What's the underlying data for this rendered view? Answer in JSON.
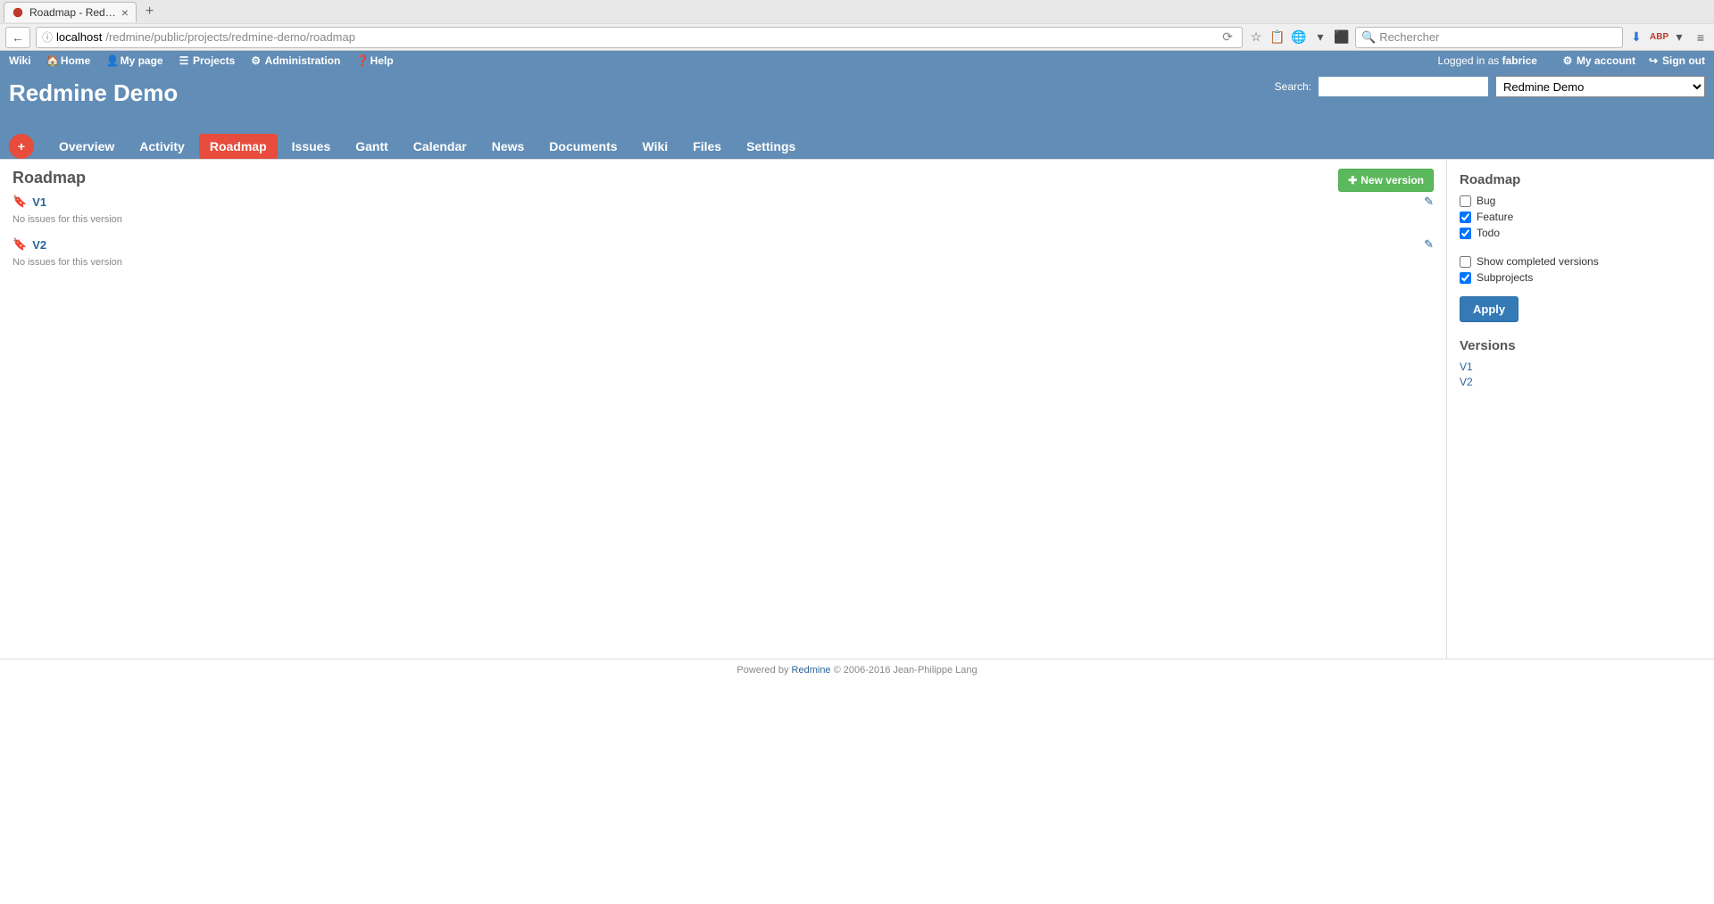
{
  "browser": {
    "tab_title": "Roadmap - Red…",
    "url_host": "localhost",
    "url_path": "/redmine/public/projects/redmine-demo/roadmap",
    "search_placeholder": "Rechercher"
  },
  "top_menu": {
    "wiki": "Wiki",
    "home": "Home",
    "my_page": "My page",
    "projects": "Projects",
    "administration": "Administration",
    "help": "Help",
    "logged_in_as": "Logged in as",
    "username": "fabrice",
    "my_account": "My account",
    "sign_out": "Sign out"
  },
  "header": {
    "title": "Redmine Demo",
    "search_label": "Search:",
    "project_jump_value": "Redmine Demo"
  },
  "main_menu": {
    "items": [
      {
        "label": "Overview",
        "selected": false
      },
      {
        "label": "Activity",
        "selected": false
      },
      {
        "label": "Roadmap",
        "selected": true
      },
      {
        "label": "Issues",
        "selected": false
      },
      {
        "label": "Gantt",
        "selected": false
      },
      {
        "label": "Calendar",
        "selected": false
      },
      {
        "label": "News",
        "selected": false
      },
      {
        "label": "Documents",
        "selected": false
      },
      {
        "label": "Wiki",
        "selected": false
      },
      {
        "label": "Files",
        "selected": false
      },
      {
        "label": "Settings",
        "selected": false
      }
    ]
  },
  "content": {
    "title": "Roadmap",
    "new_version_label": "New version",
    "versions": [
      {
        "name": "V1",
        "no_issues": "No issues for this version"
      },
      {
        "name": "V2",
        "no_issues": "No issues for this version"
      }
    ]
  },
  "sidebar": {
    "title_roadmap": "Roadmap",
    "trackers": [
      {
        "label": "Bug",
        "checked": false
      },
      {
        "label": "Feature",
        "checked": true
      },
      {
        "label": "Todo",
        "checked": true
      }
    ],
    "options": [
      {
        "label": "Show completed versions",
        "checked": false
      },
      {
        "label": "Subprojects",
        "checked": true
      }
    ],
    "apply": "Apply",
    "title_versions": "Versions",
    "versions": [
      {
        "label": "V1"
      },
      {
        "label": "V2"
      }
    ]
  },
  "footer": {
    "powered_by": "Powered by ",
    "redmine": "Redmine",
    "copyright": " © 2006-2016 Jean-Philippe Lang"
  }
}
